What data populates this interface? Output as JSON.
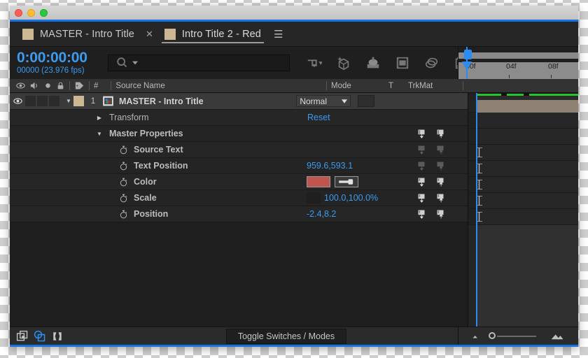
{
  "window": {
    "traffic_lights": [
      "close",
      "minimize",
      "zoom"
    ]
  },
  "tabs": [
    {
      "label": "MASTER - Intro Title",
      "active": false,
      "swatch_color": "#cdb792",
      "closable": true
    },
    {
      "label": "Intro Title 2 - Red",
      "active": true,
      "swatch_color": "#cdb792",
      "menu": "☰"
    }
  ],
  "toolbar": {
    "timecode": "0:00:00:00",
    "frames_fps": "00000 (23.976 fps)",
    "search_placeholder": "",
    "search_value": "",
    "icons": [
      "live-update-icon",
      "draft-3d-icon",
      "hide-shy-layers-icon",
      "frame-blending-icon",
      "motion-blur-icon",
      "graph-editor-icon"
    ]
  },
  "ruler": {
    "ticks": [
      "00f",
      "04f",
      "08f"
    ],
    "playhead_label": "0"
  },
  "columns": {
    "icons": [
      "eye-icon",
      "audio-icon",
      "solo-icon",
      "lock-icon",
      "label-icon"
    ],
    "number": "#",
    "source_name": "Source Name",
    "mode": "Mode",
    "t": "T",
    "trkmat": "TrkMat"
  },
  "rows": [
    {
      "type": "layer",
      "name": "MASTER - Intro Title",
      "number": "1",
      "swatch_color": "#cdb792",
      "mode": "Normal",
      "twisty": "▼",
      "visible": true
    },
    {
      "type": "property",
      "name": "Transform",
      "value": "Reset",
      "value_kind": "reset",
      "indent": 1,
      "twisty": "▶"
    },
    {
      "type": "property",
      "name": "Master Properties",
      "value": "",
      "indent": 1,
      "twisty": "▼",
      "master_icons": "bright"
    },
    {
      "type": "property",
      "name": "Source Text",
      "value": "",
      "indent": 2,
      "stopwatch": true,
      "master_icons": "dim"
    },
    {
      "type": "property",
      "name": "Text Position",
      "value": "959.6,593.1",
      "indent": 2,
      "stopwatch": true,
      "master_icons": "dim"
    },
    {
      "type": "property",
      "name": "Color",
      "value": "",
      "indent": 2,
      "stopwatch": true,
      "color_swatch": "#c0544e",
      "eyedropper": true,
      "master_icons": "bright"
    },
    {
      "type": "property",
      "name": "Scale",
      "value": "100.0,100.0%",
      "indent": 2,
      "stopwatch": true,
      "master_icons": "bright"
    },
    {
      "type": "property",
      "name": "Position",
      "value": "-2.4,8.2",
      "indent": 2,
      "stopwatch": true,
      "master_icons": "bright"
    }
  ],
  "footer": {
    "icons": [
      "comp-switches-icon",
      "transfer-controls-icon",
      "in-out-stretch-icon"
    ],
    "toggle_label": "Toggle Switches / Modes",
    "zoom_out_icon": "zoom-out-icon",
    "zoom_in_icon": "zoom-in-icon"
  },
  "colors": {
    "accent_blue": "#3b9bf0",
    "playhead_blue": "#2a8cf0",
    "render_green": "#27c328",
    "layer_bar": "#8d8273",
    "label_swatch": "#cdb792",
    "color_property": "#c0544e"
  }
}
